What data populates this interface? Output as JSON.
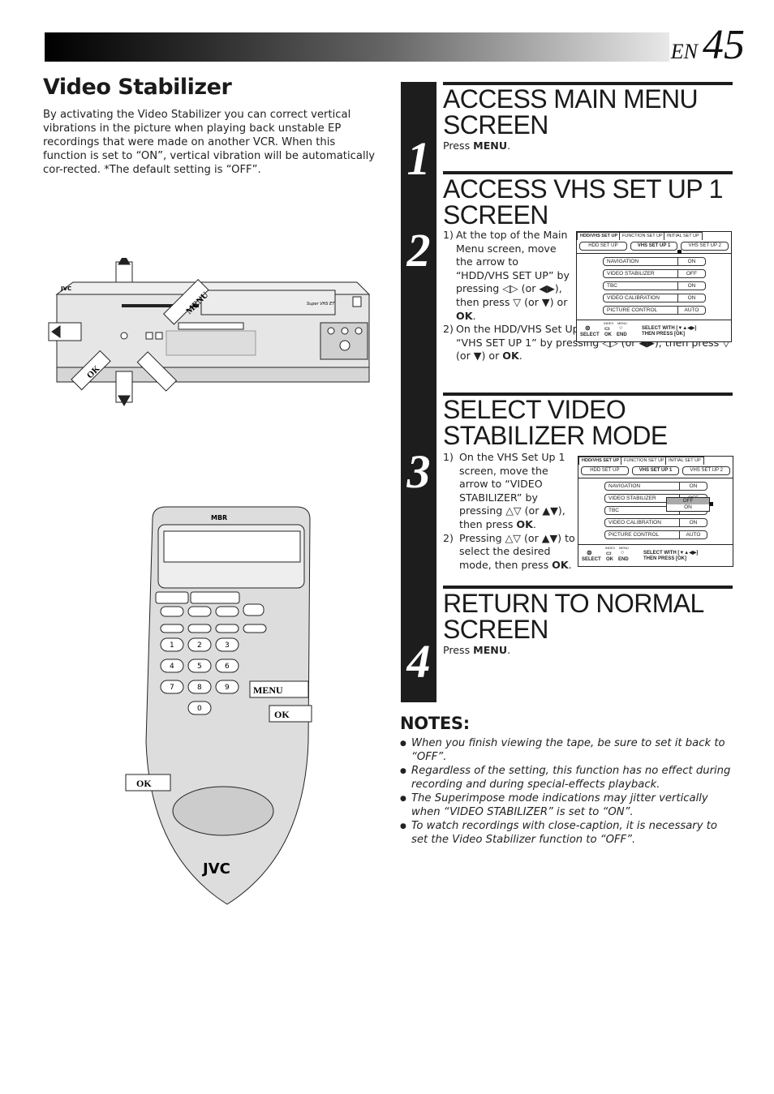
{
  "header": {
    "lang": "EN",
    "page_number": "45"
  },
  "section": {
    "title": "Video Stabilizer",
    "intro": "By activating the Video Stabilizer you can correct vertical vibrations in the picture when playing back unstable EP recordings that were made on another VCR. When this function is set to “ON”, vertical vibration will be automatically cor-rected. *The default setting is “OFF”."
  },
  "illustrations": {
    "vcr": {
      "brand": "JVC",
      "logo_text": "Super VHS ET",
      "callouts": [
        "MENU",
        "OK"
      ]
    },
    "remote": {
      "brand": "JVC",
      "top_text": "MBR",
      "callouts": [
        "MENU",
        "OK",
        "OK"
      ],
      "keypad": [
        "1",
        "2",
        "3",
        "4",
        "5",
        "6",
        "7",
        "8",
        "9",
        "0"
      ]
    }
  },
  "steps": [
    {
      "number": "1",
      "title": "ACCESS MAIN MENU SCREEN",
      "text_prefix": "Press ",
      "text_bold": "MENU",
      "text_suffix": "."
    },
    {
      "number": "2",
      "title": "ACCESS VHS SET UP 1 SCREEN",
      "items": [
        {
          "n": "1)",
          "html": "At the top of the Main Menu screen, move the arrow to “HDD/VHS SET UP” by pressing ◁▷ (or ◀▶), then press ▽ (or ▼) or <b>OK</b>."
        },
        {
          "n": "2)",
          "html": "On the HDD/VHS Set Up screen, move the arrow to “VHS SET UP 1” by pressing ◁▷ (or ◀▶), then press ▽ (or ▼) or <b>OK</b>."
        }
      ]
    },
    {
      "number": "3",
      "title": "SELECT VIDEO STABILIZER MODE",
      "items": [
        {
          "n": "1)",
          "html": "On the VHS Set Up 1 screen, move the arrow to “VIDEO STABILIZER” by pressing △▽ (or ▲▼), then press <b>OK</b>."
        },
        {
          "n": "2)",
          "html": "Pressing △▽ (or ▲▼) to select the desired mode, then press <b>OK</b>."
        }
      ]
    },
    {
      "number": "4",
      "title": "RETURN TO NORMAL SCREEN",
      "text_prefix": "Press ",
      "text_bold": "MENU",
      "text_suffix": "."
    }
  ],
  "osd": {
    "tabs": [
      "HDD/VHS SET UP",
      "FUNCTION SET UP",
      "INITIAL SET UP"
    ],
    "subtabs": [
      "HDD SET UP",
      "VHS SET UP 1",
      "VHS SET UP 2"
    ],
    "rows": [
      {
        "label": "NAVIGATION",
        "value": "ON"
      },
      {
        "label": "VIDEO STABILIZER",
        "value": "OFF"
      },
      {
        "label": "TBC",
        "value": "ON"
      },
      {
        "label": "VIDEO CALIBRATION",
        "value": "ON"
      },
      {
        "label": "PICTURE CONTROL",
        "value": "AUTO"
      }
    ],
    "dropdown_options": [
      "OFF",
      "ON"
    ],
    "dropdown_selected": "OFF",
    "footer": {
      "select": "SELECT",
      "ok": "OK",
      "end": "END",
      "index_label": "INDEX",
      "menu_label": "MENU",
      "line1": "SELECT WITH  [▼▲◀▶]",
      "line2": "THEN PRESS  [OK]"
    }
  },
  "notes": {
    "title": "NOTES:",
    "items": [
      "When you finish viewing the tape, be sure to set it back to “OFF”.",
      "Regardless of the setting, this function has no effect during recording and during special-effects playback.",
      "The Superimpose mode indications may jitter vertically when “VIDEO STABILIZER” is set to “ON”.",
      "To watch recordings with close-caption, it is necessary to set the Video Stabilizer function to “OFF”."
    ]
  }
}
